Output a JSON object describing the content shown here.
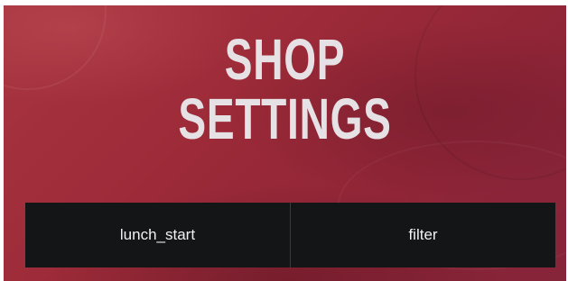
{
  "header": {
    "title_line1": "SHOP",
    "title_line2": "SETTINGS"
  },
  "buttons": [
    {
      "label": "lunch_start"
    },
    {
      "label": "filter"
    }
  ],
  "colors": {
    "background": "#9c2a38",
    "button_bar": "#141517",
    "title_text": "#e6e1e4",
    "button_text": "#f2f2f2"
  }
}
